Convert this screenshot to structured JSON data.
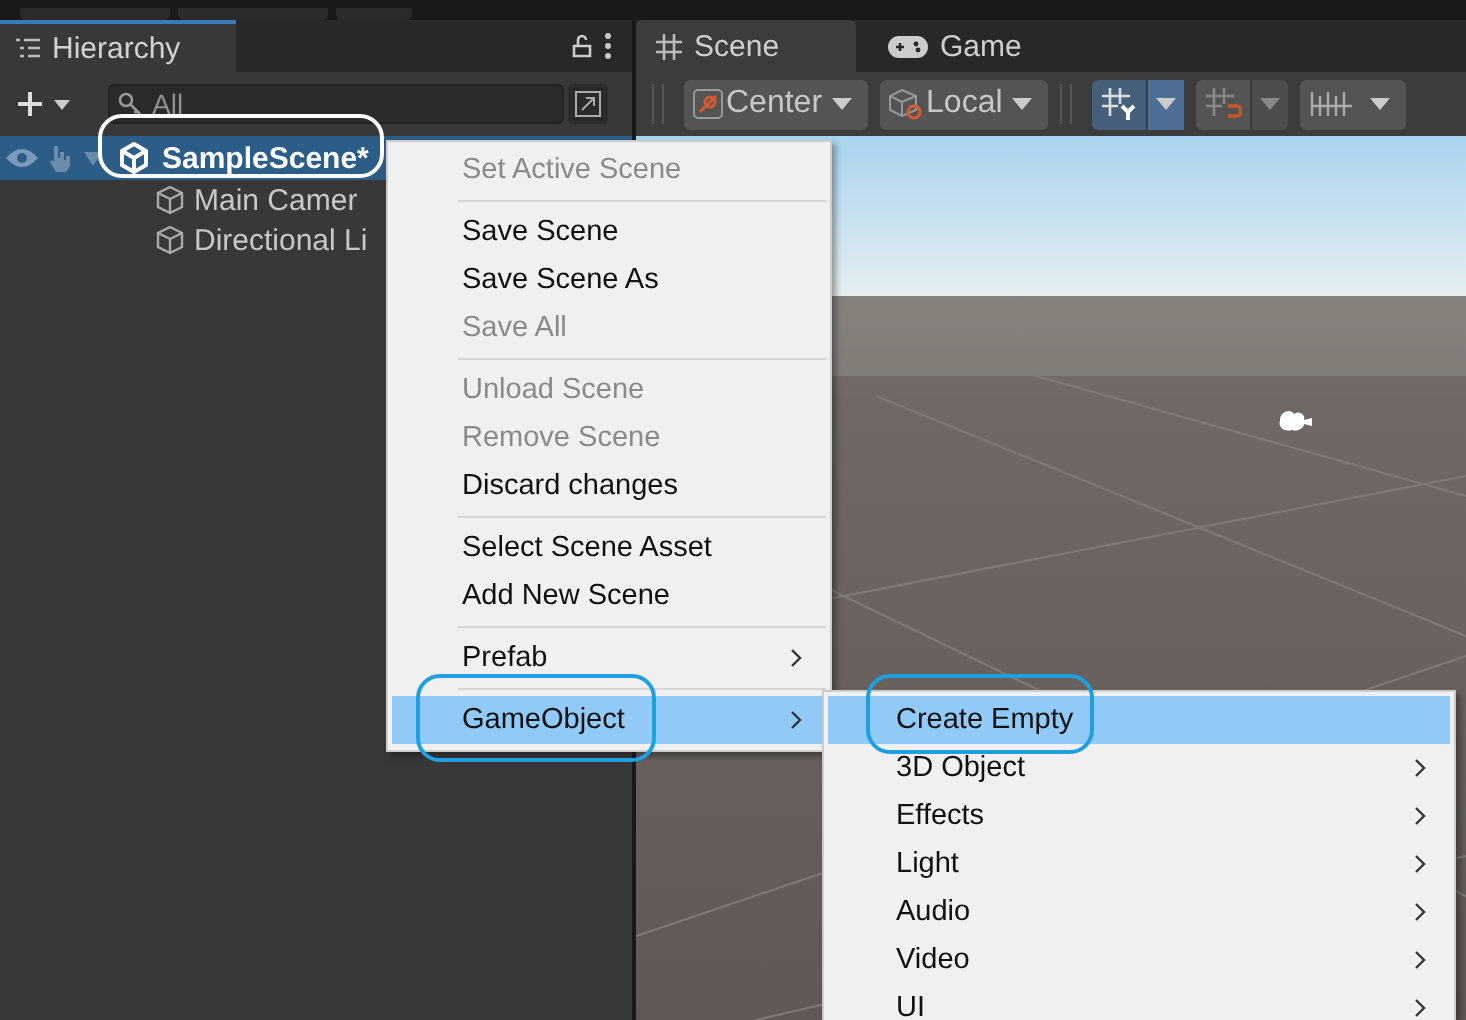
{
  "hierarchy": {
    "title": "Hierarchy",
    "search": {
      "placeholder": "All"
    },
    "scene": {
      "name": "SampleScene*",
      "selected": true,
      "circled": true,
      "children": [
        {
          "name": "Main Camer"
        },
        {
          "name": "Directional Li"
        }
      ]
    }
  },
  "scene_view": {
    "tabs": [
      {
        "label": "Scene",
        "selected": true
      },
      {
        "label": "Game",
        "selected": false
      }
    ],
    "toolbar": {
      "pivot": "Center",
      "space": "Local",
      "grid_snap_on": true
    }
  },
  "context_menu": {
    "groups": [
      [
        {
          "label": "Set Active Scene",
          "disabled": true,
          "submenu": false,
          "selected": false,
          "circled": false
        }
      ],
      [
        {
          "label": "Save Scene",
          "disabled": false,
          "submenu": false,
          "selected": false,
          "circled": false
        },
        {
          "label": "Save Scene As",
          "disabled": false,
          "submenu": false,
          "selected": false,
          "circled": false
        },
        {
          "label": "Save All",
          "disabled": true,
          "submenu": false,
          "selected": false,
          "circled": false
        }
      ],
      [
        {
          "label": "Unload Scene",
          "disabled": true,
          "submenu": false,
          "selected": false,
          "circled": false
        },
        {
          "label": "Remove Scene",
          "disabled": true,
          "submenu": false,
          "selected": false,
          "circled": false
        },
        {
          "label": "Discard changes",
          "disabled": false,
          "submenu": false,
          "selected": false,
          "circled": false
        }
      ],
      [
        {
          "label": "Select Scene Asset",
          "disabled": false,
          "submenu": false,
          "selected": false,
          "circled": false
        },
        {
          "label": "Add New Scene",
          "disabled": false,
          "submenu": false,
          "selected": false,
          "circled": false
        }
      ],
      [
        {
          "label": "Prefab",
          "disabled": false,
          "submenu": true,
          "selected": false,
          "circled": false
        }
      ],
      [
        {
          "label": "GameObject",
          "disabled": false,
          "submenu": true,
          "selected": true,
          "circled": true
        }
      ]
    ]
  },
  "submenu": {
    "items": [
      {
        "label": "Create Empty",
        "submenu": false,
        "selected": true,
        "circled": true
      },
      {
        "label": "3D Object",
        "submenu": true,
        "selected": false,
        "circled": false
      },
      {
        "label": "Effects",
        "submenu": true,
        "selected": false,
        "circled": false
      },
      {
        "label": "Light",
        "submenu": true,
        "selected": false,
        "circled": false
      },
      {
        "label": "Audio",
        "submenu": true,
        "selected": false,
        "circled": false
      },
      {
        "label": "Video",
        "submenu": true,
        "selected": false,
        "circled": false
      },
      {
        "label": "UI",
        "submenu": true,
        "selected": false,
        "circled": false
      }
    ]
  }
}
